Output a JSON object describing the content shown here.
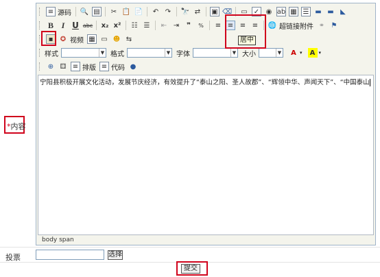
{
  "form": {
    "content_label_star": "*",
    "content_label": "内容",
    "vote_label": "投票",
    "select_button": "选择",
    "submit_button": "提交"
  },
  "toolbar": {
    "source_label": "源码",
    "video_label": "视频",
    "link_label": "超链接附件",
    "layout_label": "排版",
    "code_label": "代码",
    "style_label": "样式",
    "format_label": "格式",
    "font_label": "字体",
    "size_label": "大小",
    "tooltip": "居中"
  },
  "editor": {
    "text": "宁阳县积极开展文化活动，发展节庆经济，有效提升了“泰山之阳、圣人故郡”、“辉领中华、声闻天下”、“中国泰山",
    "status_path": "body  span"
  }
}
